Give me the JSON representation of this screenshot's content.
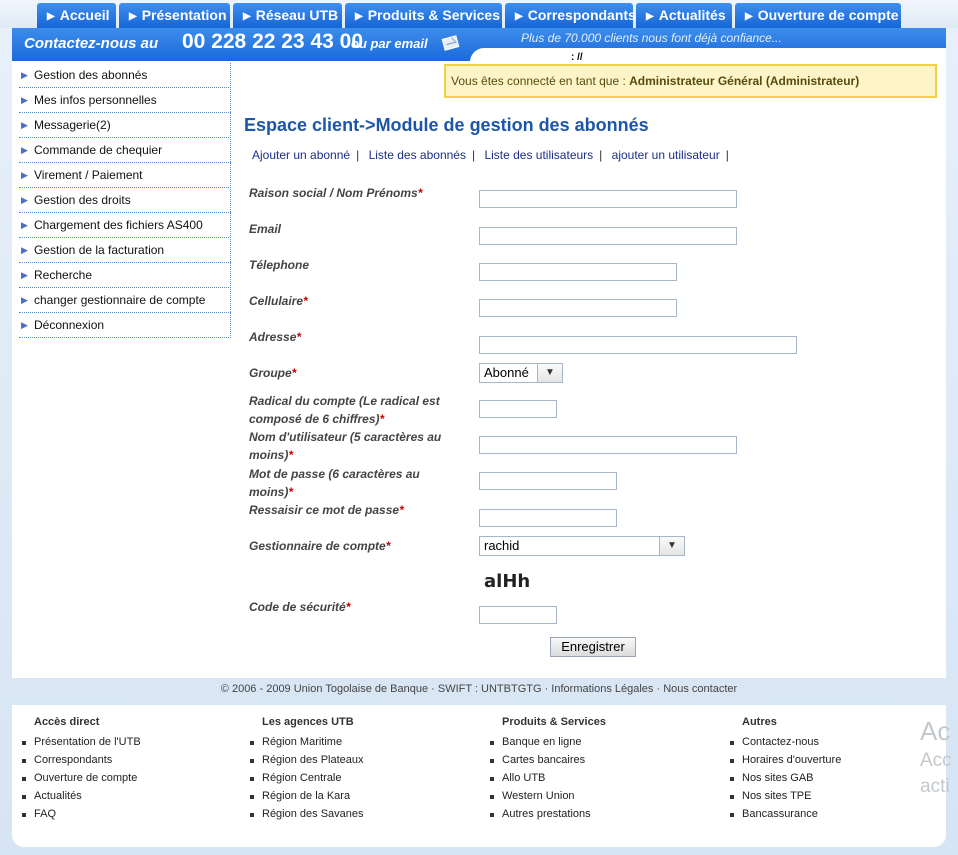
{
  "nav": {
    "tabs": [
      "Accueil",
      "Présentation",
      "Réseau UTB",
      "Produits & Services",
      "Correspondants",
      "Actualités",
      "Ouverture de compte"
    ]
  },
  "contact": {
    "prefix": "Contactez-nous au",
    "phone": "00 228 22 23 43 00",
    "suffix": "ou par email",
    "slogan": "Plus de 70.000 clients nous font déjà confiance...",
    "tiny_text": ": //"
  },
  "sidebar": {
    "items": [
      "Gestion des abonnés",
      "Mes infos personnelles",
      "Messagerie(2)",
      "Commande de chequier",
      "Virement / Paiement",
      "Gestion des droits",
      "Chargement des fichiers AS400",
      "Gestion de la facturation",
      "Recherche",
      "changer gestionnaire de compte",
      "Déconnexion"
    ]
  },
  "connected": {
    "prefix": "Vous êtes connecté en tant que :",
    "user": "Administrateur Général (Administrateur)"
  },
  "main": {
    "title": "Espace client->Module de gestion des abonnés",
    "sublinks": [
      "Ajouter un abonné",
      "Liste des abonnés",
      "Liste des utilisateurs",
      "ajouter un utilisateur"
    ]
  },
  "form": {
    "raison_social": "Raison social / Nom Prénoms",
    "email": "Email",
    "telephone": "Télephone",
    "cellulaire": "Cellulaire",
    "adresse": "Adresse",
    "groupe": "Groupe",
    "groupe_value": "Abonné",
    "radical_a": "Radical du compte (Le radical est",
    "radical_b": "composé de 6 chiffres)",
    "nom_utilisateur_a": "Nom d'utilisateur (5 caractères au",
    "nom_utilisateur_b": "moins)",
    "mot_de_passe_a": "Mot de passe (6 caractères au",
    "mot_de_passe_b": "moins)",
    "ressaisir": "Ressaisir ce mot de passe",
    "gestionnaire": "Gestionnaire de compte",
    "gestionnaire_value": "rachid",
    "captcha": "alHh",
    "code_securite": "Code de sécurité",
    "required_mark": "*",
    "submit": "Enregistrer"
  },
  "footer": {
    "copyright": "© 2006 - 2009 Union Togolaise de Banque · SWIFT : UNTBTGTG · Informations Légales · Nous contacter",
    "columns": [
      {
        "title": "Accès direct",
        "items": [
          "Présentation de l'UTB",
          "Correspondants",
          "Ouverture de compte",
          "Actualités",
          "FAQ"
        ]
      },
      {
        "title": "Les agences UTB",
        "items": [
          "Région Maritime",
          "Région des Plateaux",
          "Région Centrale",
          "Région de la Kara",
          "Région des Savanes"
        ]
      },
      {
        "title": "Produits & Services",
        "items": [
          "Banque en ligne",
          "Cartes bancaires",
          "Allo UTB",
          "Western Union",
          "Autres prestations"
        ]
      },
      {
        "title": "Autres",
        "items": [
          "Contactez-nous",
          "Horaires d'ouverture",
          "Nos sites GAB",
          "Nos sites TPE",
          "Bancassurance"
        ]
      }
    ]
  },
  "watermark": {
    "line1": "Ac",
    "line2": "Acc",
    "line3": "acti"
  },
  "colors": {
    "nav_blue": "#1665d6",
    "title_blue": "#1d56a8",
    "required_red": "#cc0000",
    "notice_bg": "#fdf5c8",
    "notice_border": "#f3d04a"
  }
}
